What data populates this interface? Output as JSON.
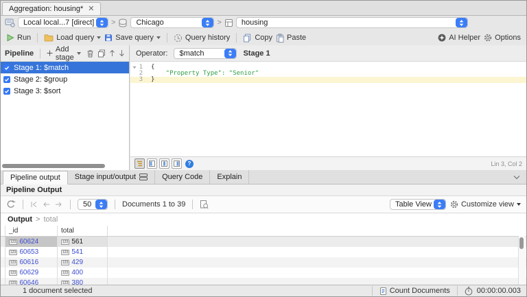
{
  "tab": {
    "title": "Aggregation: housing*"
  },
  "connection": {
    "server": "Local local...7 [direct]",
    "database": "Chicago",
    "collection": "housing"
  },
  "toolbar": {
    "run": "Run",
    "load_query": "Load query",
    "save_query": "Save query",
    "query_history": "Query history",
    "copy": "Copy",
    "paste": "Paste",
    "ai_helper": "AI Helper",
    "options": "Options"
  },
  "pipeline": {
    "title": "Pipeline",
    "add_stage": "Add stage",
    "stages": [
      {
        "label": "Stage 1: $match"
      },
      {
        "label": "Stage 2: $group"
      },
      {
        "label": "Stage 3: $sort"
      }
    ]
  },
  "stage_editor": {
    "operator_label": "Operator:",
    "operator": "$match",
    "stage_title": "Stage 1",
    "lines": [
      {
        "num": "1",
        "code": "{"
      },
      {
        "num": "2",
        "code": "    \"Property Type\": \"Senior\""
      },
      {
        "num": "3",
        "code": "}"
      }
    ],
    "cursor": "Lin 3, Col 2"
  },
  "output_tabs": {
    "pipeline_output": "Pipeline output",
    "stage_io": "Stage input/output",
    "query_code": "Query Code",
    "explain": "Explain"
  },
  "results": {
    "section_title": "Pipeline Output",
    "page_size": "50",
    "range": "Documents 1 to 39",
    "view_mode": "Table View",
    "customize": "Customize view",
    "breadcrumb_root": "Output",
    "breadcrumb_field": "total",
    "columns": [
      "_id",
      "total"
    ],
    "type_badge": "123",
    "rows": [
      {
        "id": "60624",
        "total": "561"
      },
      {
        "id": "60653",
        "total": "541"
      },
      {
        "id": "60616",
        "total": "429"
      },
      {
        "id": "60629",
        "total": "400"
      },
      {
        "id": "60646",
        "total": "380"
      }
    ]
  },
  "status": {
    "selection": "1 document selected",
    "count_documents": "Count Documents",
    "time": "00:00:00.003"
  },
  "colors": {
    "accent_blue": "#3b7df7",
    "selection_blue": "#3674d9",
    "string_green": "#2f9e44",
    "value_blue": "#3d4ed0",
    "current_line_yellow": "#fcf5d2"
  }
}
